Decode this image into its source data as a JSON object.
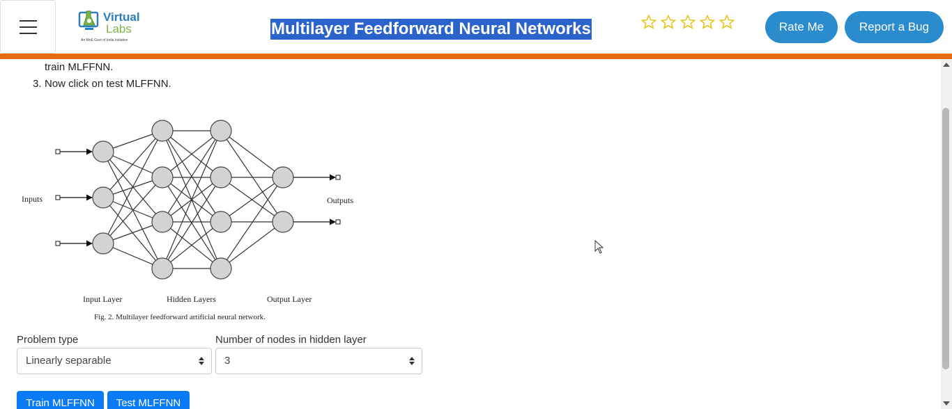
{
  "header": {
    "menu_icon": "hamburger-icon",
    "logo": {
      "word1": "Virtual",
      "word2": "Labs",
      "tagline": "An MoE Govt of India Initiative"
    },
    "title": "Multilayer Feedforward Neural Networks",
    "rating_stars": 5,
    "rating_value": 0,
    "rate_label": "Rate Me",
    "bug_label": "Report a Bug",
    "accent_color": "#e86a10"
  },
  "instructions": {
    "line_partial": "train MLFFNN.",
    "step3_number": "3.",
    "step3_text": "Now click on test MLFFNN."
  },
  "figure": {
    "inputs_label": "Inputs",
    "outputs_label": "Outputs",
    "input_layer_label": "Input Layer",
    "hidden_layers_label": "Hidden Layers",
    "output_layer_label": "Output Layer",
    "caption": "Fig.  2.  Multilayer feedforward artificial neural network.",
    "layer_sizes": [
      3,
      4,
      4,
      2
    ]
  },
  "form": {
    "problem_type_label": "Problem type",
    "problem_type_value": "Linearly separable",
    "nodes_label": "Number of nodes in hidden layer",
    "nodes_value": "3",
    "train_label": "Train MLFFNN",
    "test_label": "Test MLFFNN"
  }
}
